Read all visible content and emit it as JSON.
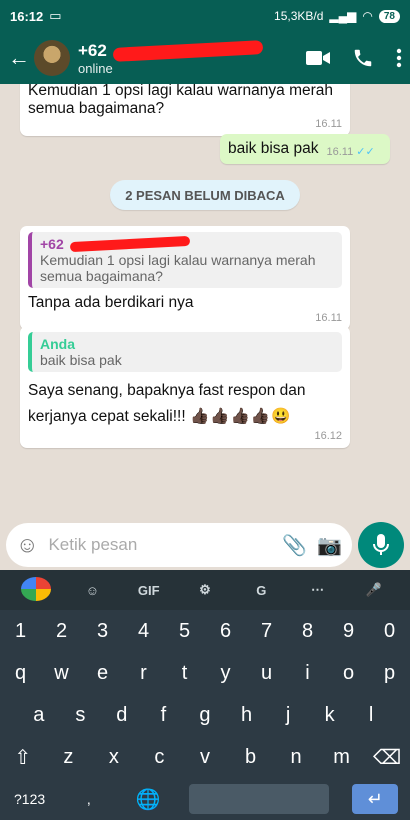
{
  "status": {
    "time": "16:12",
    "network": "15,3KB/d",
    "battery": "78"
  },
  "header": {
    "name": "+62",
    "state": "online"
  },
  "messages": {
    "m1": {
      "text": "Kemudian 1 opsi lagi kalau warnanya merah semua bagaimana?",
      "time": "16.11"
    },
    "m2": {
      "text": "baik bisa pak",
      "time": "16.11",
      "ticks": "✓✓"
    },
    "unread": "2 PESAN BELUM DIBACA",
    "m3": {
      "quote_name": "+62",
      "quote_text": "Kemudian 1 opsi lagi kalau warnanya merah semua bagaimana?",
      "text": "Tanpa ada berdikari nya",
      "time": "16.11"
    },
    "m4": {
      "quote_name": "Anda",
      "quote_text": "baik bisa pak",
      "text": "Saya senang, bapaknya fast respon dan kerjanya cepat sekali!!!",
      "emoji": "👍🏿👍🏿👍🏿👍🏿😃",
      "time": "16.12"
    }
  },
  "input": {
    "placeholder": "Ketik pesan"
  },
  "keyboard": {
    "toolbar": [
      "GIF",
      "⚙",
      "⋯"
    ],
    "row_numbers": [
      "1",
      "2",
      "3",
      "4",
      "5",
      "6",
      "7",
      "8",
      "9",
      "0"
    ],
    "row1": [
      "q",
      "w",
      "e",
      "r",
      "t",
      "y",
      "u",
      "i",
      "o",
      "p"
    ],
    "row2": [
      "a",
      "s",
      "d",
      "f",
      "g",
      "h",
      "j",
      "k",
      "l"
    ],
    "row3": [
      "z",
      "x",
      "c",
      "v",
      "b",
      "n",
      "m"
    ],
    "sym": "?123",
    "comma": ","
  },
  "colors": {
    "header": "#075e54",
    "outgoing": "#dcf8c6",
    "accent": "#00897b"
  }
}
